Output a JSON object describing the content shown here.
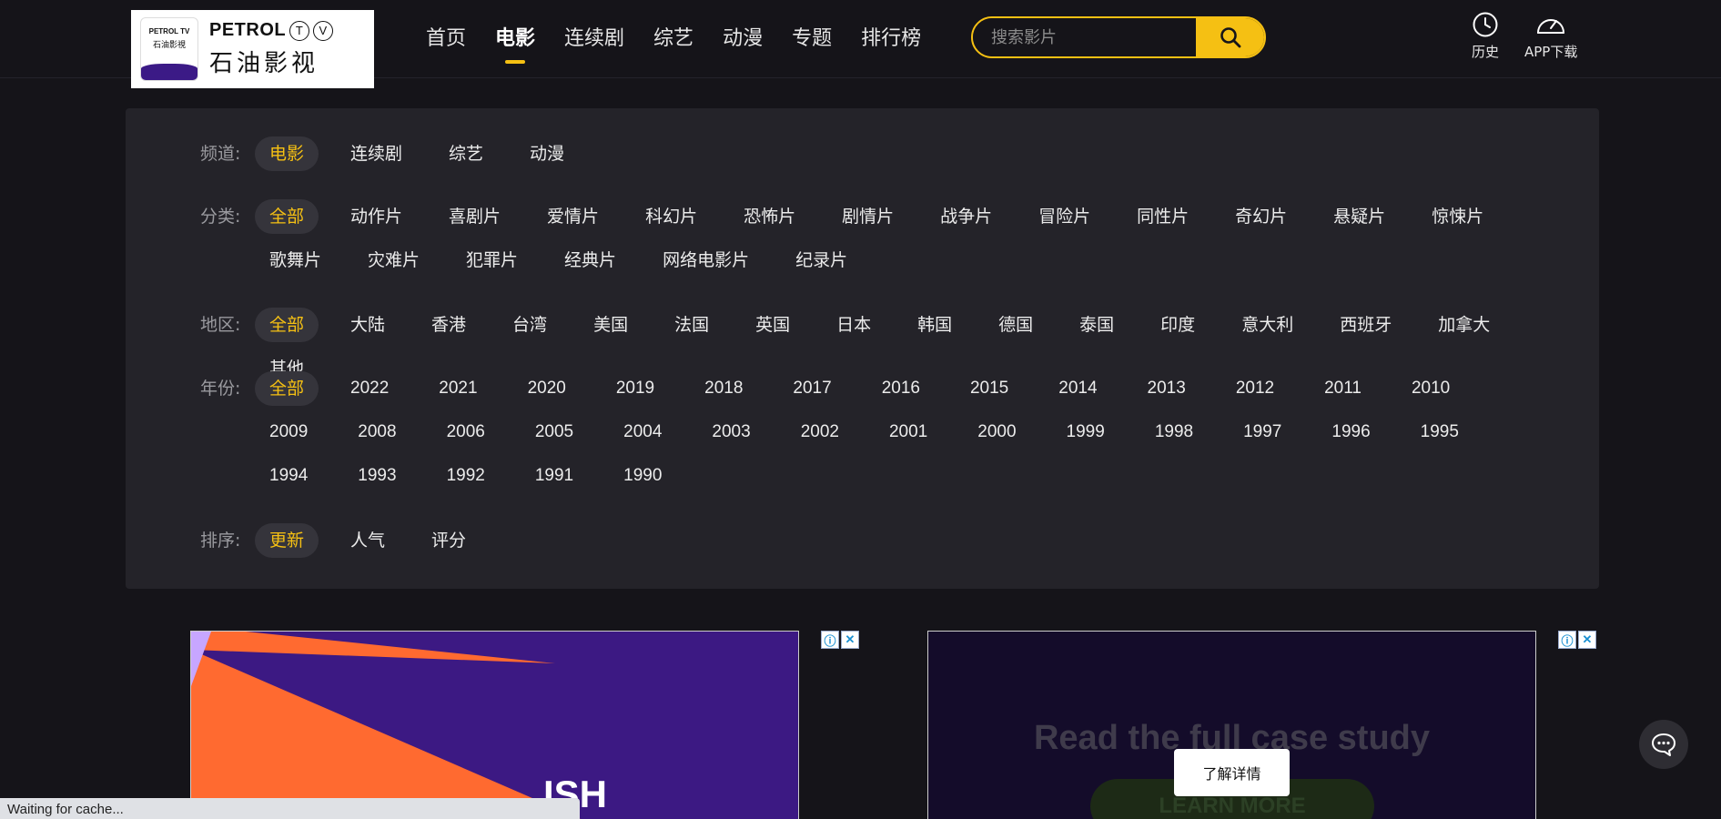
{
  "header": {
    "logo": {
      "brand_en": "PETROL",
      "brand_tv": "TV",
      "brand_zh": "石油影视",
      "badge_top": "PETROL TV",
      "badge_zh": "石油影視"
    },
    "nav": [
      {
        "label": "首页",
        "active": false
      },
      {
        "label": "电影",
        "active": true
      },
      {
        "label": "连续剧",
        "active": false
      },
      {
        "label": "综艺",
        "active": false
      },
      {
        "label": "动漫",
        "active": false
      },
      {
        "label": "专题",
        "active": false
      },
      {
        "label": "排行榜",
        "active": false
      }
    ],
    "search": {
      "placeholder": "搜索影片",
      "value": ""
    },
    "history_label": "历史",
    "app_label": "APP下载"
  },
  "filters": {
    "channel": {
      "label": "频道:",
      "items": [
        "电影",
        "连续剧",
        "综艺",
        "动漫"
      ],
      "selected": "电影"
    },
    "category": {
      "label": "分类:",
      "items": [
        "全部",
        "动作片",
        "喜剧片",
        "爱情片",
        "科幻片",
        "恐怖片",
        "剧情片",
        "战争片",
        "冒险片",
        "同性片",
        "奇幻片",
        "悬疑片",
        "惊悚片",
        "歌舞片",
        "灾难片",
        "犯罪片",
        "经典片",
        "网络电影片",
        "纪录片"
      ],
      "selected": "全部"
    },
    "region": {
      "label": "地区:",
      "items": [
        "全部",
        "大陆",
        "香港",
        "台湾",
        "美国",
        "法国",
        "英国",
        "日本",
        "韩国",
        "德国",
        "泰国",
        "印度",
        "意大利",
        "西班牙",
        "加拿大",
        "其他"
      ],
      "selected": "全部"
    },
    "year": {
      "label": "年份:",
      "items": [
        "全部",
        "2022",
        "2021",
        "2020",
        "2019",
        "2018",
        "2017",
        "2016",
        "2015",
        "2014",
        "2013",
        "2012",
        "2011",
        "2010",
        "2009",
        "2008",
        "2006",
        "2005",
        "2004",
        "2003",
        "2002",
        "2001",
        "2000",
        "1999",
        "1998",
        "1997",
        "1996",
        "1995",
        "1994",
        "1993",
        "1992",
        "1991",
        "1990"
      ],
      "selected": "全部"
    },
    "sort": {
      "label": "排序:",
      "items": [
        "更新",
        "人气",
        "评分"
      ],
      "selected": "更新"
    }
  },
  "ads": {
    "ad1_text": "ISH",
    "ad2_headline": "Read the full case study",
    "ad2_cta": "LEARN MORE",
    "learn_more_label": "了解详情",
    "info_icon": "ⓘ",
    "close_icon": "✕"
  },
  "status_bar": "Waiting for cache...",
  "colors": {
    "accent": "#f5c013",
    "background": "#151419",
    "panel": "#242329"
  }
}
